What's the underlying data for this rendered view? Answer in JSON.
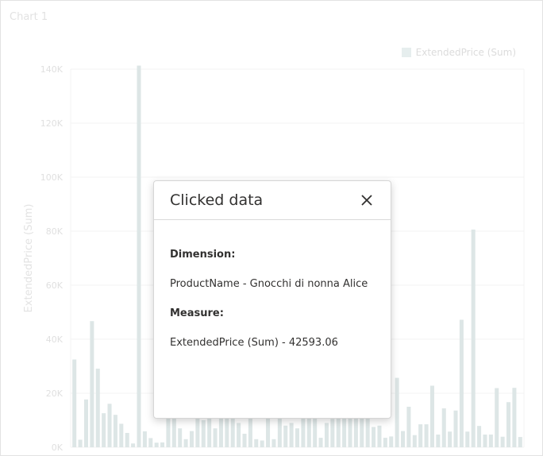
{
  "panel": {
    "title": "Chart 1"
  },
  "chart_data": {
    "type": "bar",
    "title": "",
    "ylabel": "ExtendedPrice (Sum)",
    "ylim": [
      0,
      140000
    ],
    "yticks": [
      "0K",
      "20K",
      "40K",
      "60K",
      "80K",
      "100K",
      "120K",
      "140K"
    ],
    "grid": true,
    "legend_position": "top-right",
    "series": [
      {
        "name": "ExtendedPrice (Sum)",
        "values": [
          32500,
          2800,
          17700,
          46700,
          29100,
          12600,
          16100,
          12000,
          8700,
          5300,
          1400,
          141300,
          5900,
          3400,
          1700,
          1800,
          32000,
          13000,
          7000,
          3000,
          6000,
          12000,
          10000,
          12000,
          7000,
          11000,
          11000,
          11000,
          9000,
          5000,
          11000,
          3000,
          2500,
          12000,
          3000,
          11000,
          8000,
          9000,
          7000,
          11000,
          11000,
          11000,
          3500,
          9000,
          10500,
          11000,
          11000,
          11000,
          11000,
          11000,
          11000,
          7500,
          8000,
          3500,
          4000,
          25700,
          6000,
          15000,
          4500,
          8500,
          8500,
          22800,
          4700,
          14400,
          5800,
          13600,
          47200,
          5800,
          80600,
          7900,
          4700,
          4700,
          21900,
          3900,
          16700,
          22000,
          3800
        ]
      }
    ]
  },
  "colors": {
    "bar": "#dde6e6",
    "grid": "#f3f3f3"
  },
  "dialog": {
    "title": "Clicked data",
    "dimension_label": "Dimension:",
    "dimension_value": "ProductName - Gnocchi di nonna Alice",
    "measure_label": "Measure:",
    "measure_value": "ExtendedPrice (Sum) - 42593.06",
    "close_icon": "close-icon"
  }
}
